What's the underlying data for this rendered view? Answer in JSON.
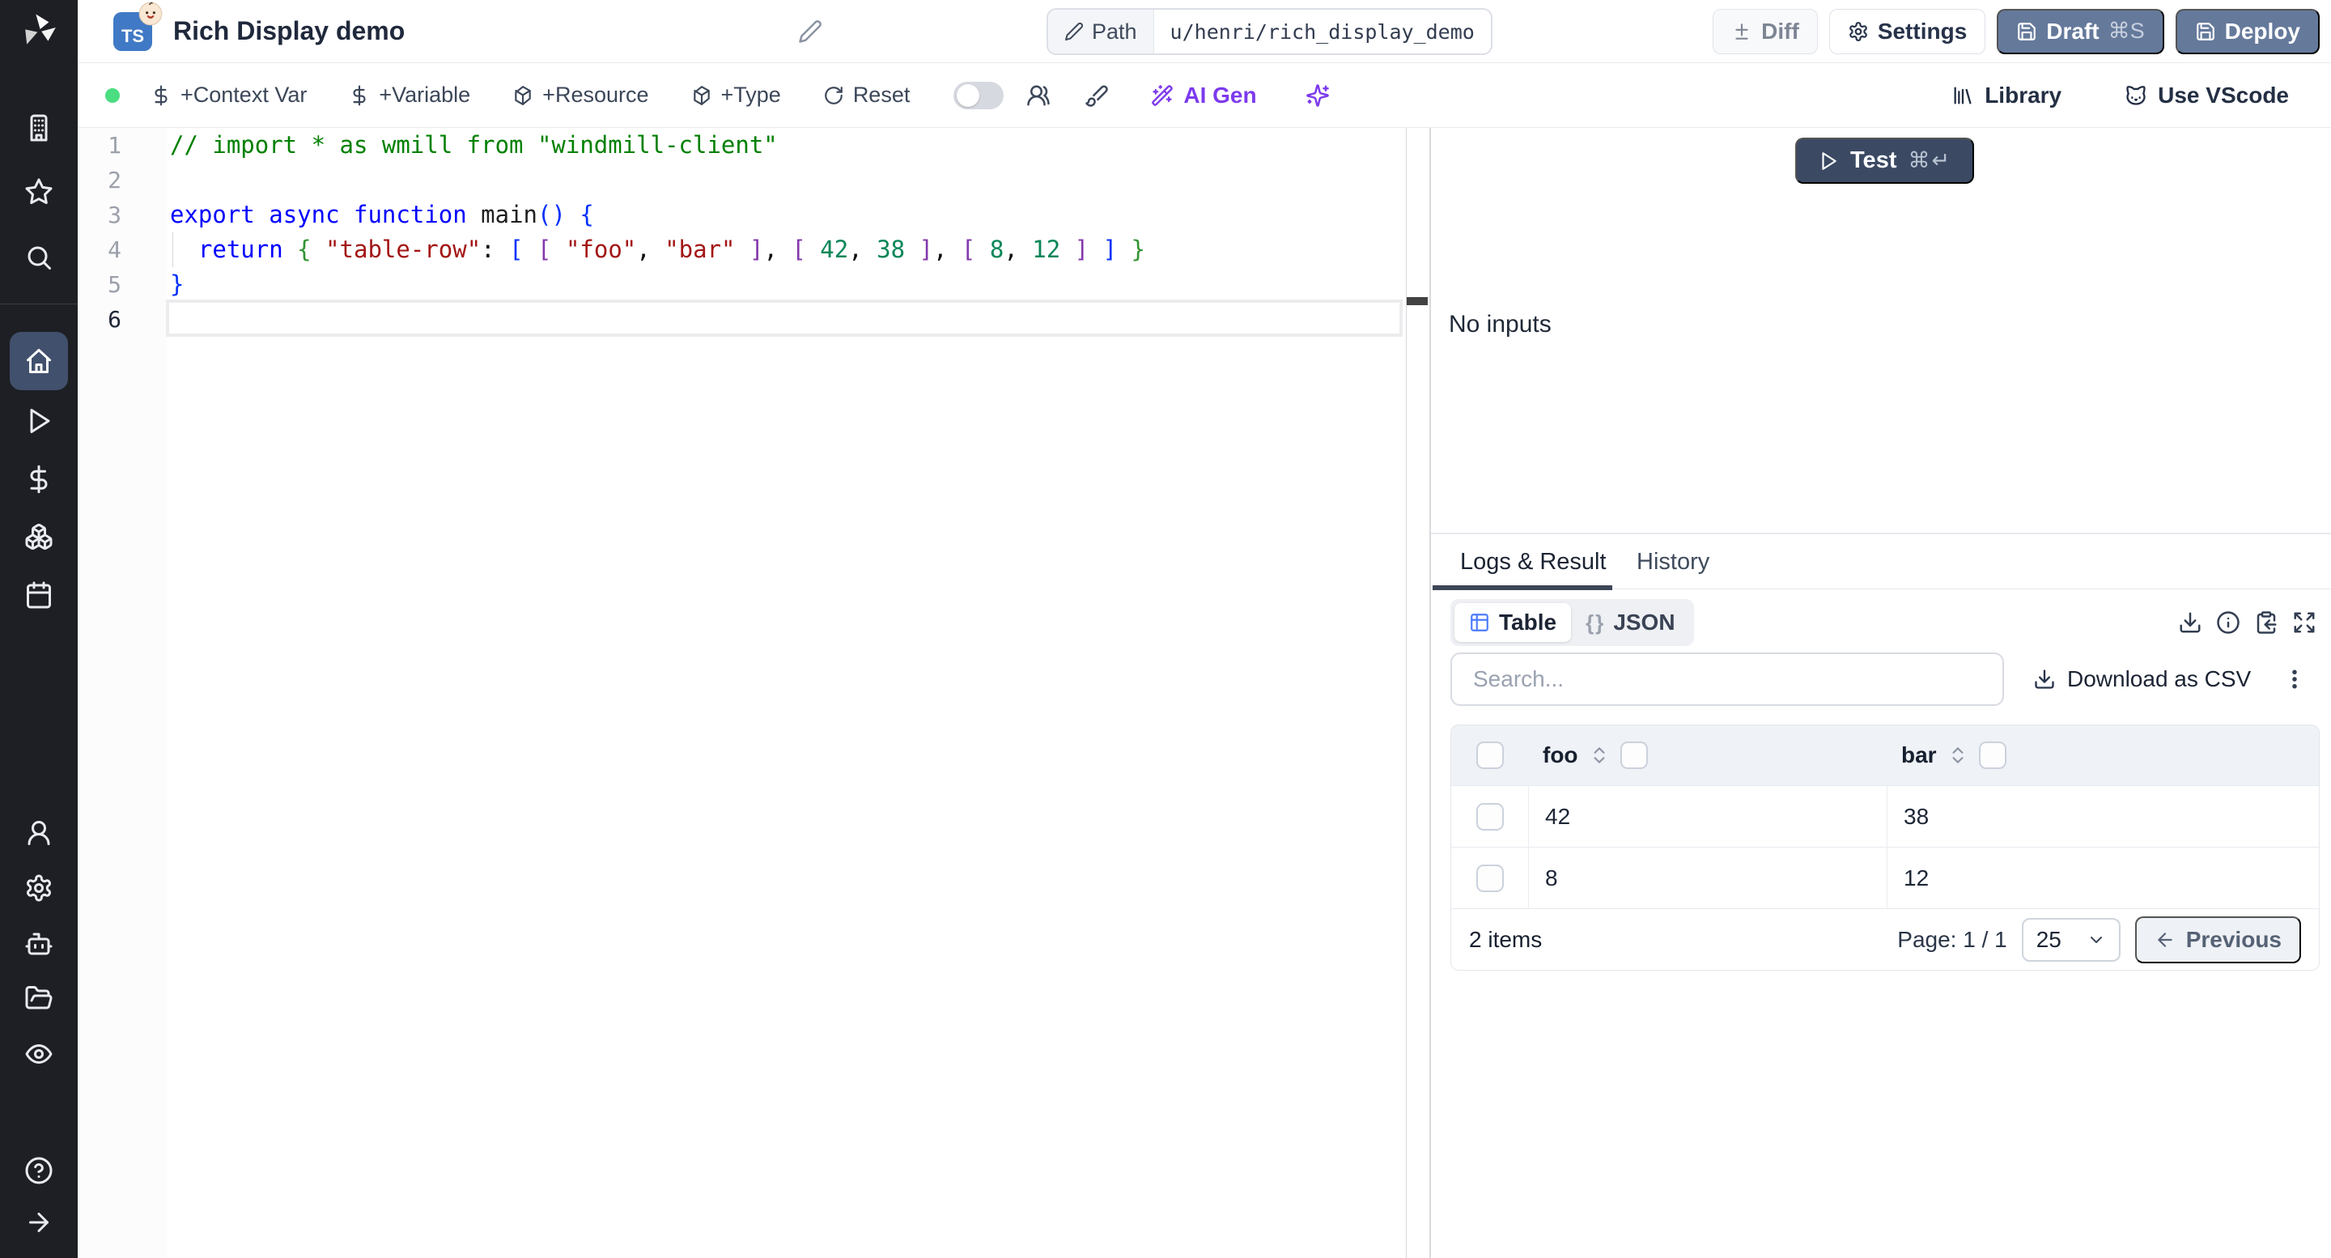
{
  "header": {
    "badge": "TS",
    "title": "Rich Display demo",
    "path_label": "Path",
    "path_value": "u/henri/rich_display_demo",
    "diff_label": "Diff",
    "settings_label": "Settings",
    "draft_label": "Draft",
    "draft_shortcut": "⌘S",
    "deploy_label": "Deploy"
  },
  "toolbar": {
    "context_var": "+Context Var",
    "variable": "+Variable",
    "resource": "+Resource",
    "type": "+Type",
    "reset": "Reset",
    "ai_gen": "AI Gen",
    "library": "Library",
    "vscode": "Use VScode"
  },
  "sidebar": {
    "icons": [
      "windmill-logo",
      "building",
      "star",
      "search",
      "home",
      "play",
      "dollar",
      "boxes",
      "calendar",
      "user",
      "settings",
      "bot",
      "folder-open",
      "eye",
      "help-circle",
      "arrow-right"
    ],
    "active": "home"
  },
  "editor": {
    "language": "typescript",
    "lines": [
      {
        "n": "1",
        "tokens": [
          {
            "t": "// import * as wmill from \"windmill-client\"",
            "c": "com"
          }
        ]
      },
      {
        "n": "2",
        "tokens": []
      },
      {
        "n": "3",
        "tokens": [
          {
            "t": "export",
            "c": "kw"
          },
          {
            "t": " ",
            "c": "pl"
          },
          {
            "t": "async",
            "c": "kw"
          },
          {
            "t": " ",
            "c": "pl"
          },
          {
            "t": "function",
            "c": "kw"
          },
          {
            "t": " ",
            "c": "pl"
          },
          {
            "t": "main",
            "c": "fn"
          },
          {
            "t": "()",
            "c": "p1"
          },
          {
            "t": " ",
            "c": "pl"
          },
          {
            "t": "{",
            "c": "p1"
          }
        ]
      },
      {
        "n": "4",
        "tokens": [
          {
            "t": "  ",
            "c": "pl"
          },
          {
            "t": "return",
            "c": "kw"
          },
          {
            "t": " ",
            "c": "pl"
          },
          {
            "t": "{",
            "c": "p2"
          },
          {
            "t": " ",
            "c": "pl"
          },
          {
            "t": "\"table-row\"",
            "c": "str"
          },
          {
            "t": ": ",
            "c": "pl"
          },
          {
            "t": "[",
            "c": "p1"
          },
          {
            "t": " ",
            "c": "pl"
          },
          {
            "t": "[",
            "c": "p3"
          },
          {
            "t": " ",
            "c": "pl"
          },
          {
            "t": "\"foo\"",
            "c": "str"
          },
          {
            "t": ", ",
            "c": "pl"
          },
          {
            "t": "\"bar\"",
            "c": "str"
          },
          {
            "t": " ",
            "c": "pl"
          },
          {
            "t": "]",
            "c": "p3"
          },
          {
            "t": ", ",
            "c": "pl"
          },
          {
            "t": "[",
            "c": "p3"
          },
          {
            "t": " ",
            "c": "pl"
          },
          {
            "t": "42",
            "c": "num"
          },
          {
            "t": ", ",
            "c": "pl"
          },
          {
            "t": "38",
            "c": "num"
          },
          {
            "t": " ",
            "c": "pl"
          },
          {
            "t": "]",
            "c": "p3"
          },
          {
            "t": ", ",
            "c": "pl"
          },
          {
            "t": "[",
            "c": "p3"
          },
          {
            "t": " ",
            "c": "pl"
          },
          {
            "t": "8",
            "c": "num"
          },
          {
            "t": ", ",
            "c": "pl"
          },
          {
            "t": "12",
            "c": "num"
          },
          {
            "t": " ",
            "c": "pl"
          },
          {
            "t": "]",
            "c": "p3"
          },
          {
            "t": " ",
            "c": "pl"
          },
          {
            "t": "]",
            "c": "p1"
          },
          {
            "t": " ",
            "c": "pl"
          },
          {
            "t": "}",
            "c": "p2"
          }
        ]
      },
      {
        "n": "5",
        "tokens": [
          {
            "t": "}",
            "c": "p1"
          }
        ]
      },
      {
        "n": "6",
        "active": true,
        "tokens": []
      }
    ]
  },
  "run": {
    "test_label": "Test",
    "test_shortcut": "⌘↵",
    "no_inputs": "No inputs"
  },
  "result": {
    "tabs": {
      "logs": "Logs & Result",
      "history": "History"
    },
    "view_toggle": {
      "table": "Table",
      "json": "JSON",
      "braces_glyph": "{}"
    },
    "search_placeholder": "Search...",
    "download_csv": "Download as CSV",
    "table": {
      "columns": [
        "foo",
        "bar"
      ],
      "rows": [
        [
          "42",
          "38"
        ],
        [
          "8",
          "12"
        ]
      ]
    },
    "footer": {
      "items": "2 items",
      "page": "Page: 1 / 1",
      "page_size": "25",
      "previous": "Previous"
    }
  },
  "colors": {
    "sidebar_bg": "#1e1f24",
    "sidebar_active_bg": "#41506c",
    "slate_button": "#65799b",
    "test_button": "#3b4963",
    "ai_purple": "#7c3aed",
    "status_green": "#4ade80",
    "table_icon_blue": "#4d7cfe",
    "comment_green": "#008000",
    "keyword_blue": "#0000ff",
    "string_red": "#a31515",
    "number_green": "#098658"
  }
}
